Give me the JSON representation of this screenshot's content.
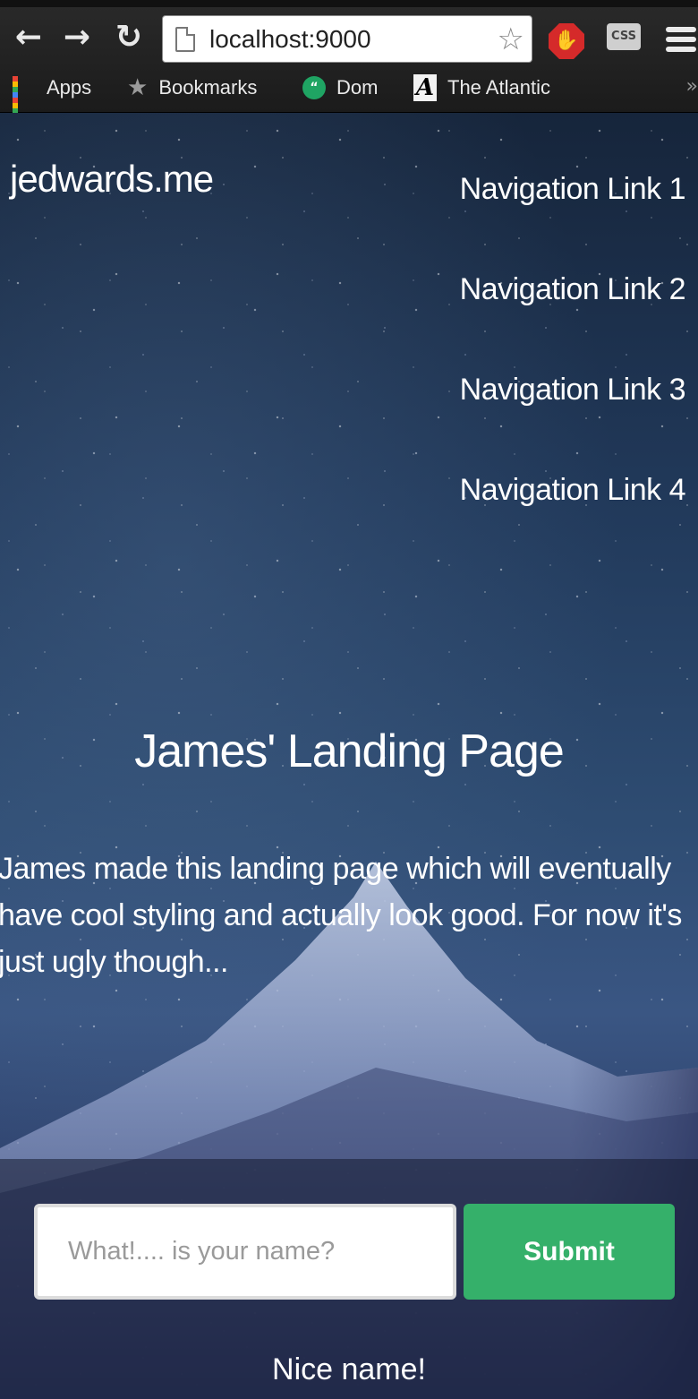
{
  "browser": {
    "url": "localhost:9000",
    "nav_icons": {
      "back": "back-arrow-icon",
      "forward": "forward-arrow-icon",
      "reload": "reload-icon"
    },
    "extensions": [
      {
        "name": "adblock-icon"
      },
      {
        "name": "css-extension-icon",
        "label": "CSS"
      }
    ],
    "bookmarks": [
      {
        "label": "Apps",
        "icon": "apps-grid-icon"
      },
      {
        "label": "Bookmarks",
        "icon": "star-icon"
      },
      {
        "label": "Dom",
        "icon": "hangouts-icon"
      },
      {
        "label": "The Atlantic",
        "icon": "atlantic-icon"
      }
    ],
    "overflow_icon": "»"
  },
  "site": {
    "brand": "jedwards.me",
    "nav_links": [
      "Navigation Link 1",
      "Navigation Link 2",
      "Navigation Link 3",
      "Navigation Link 4"
    ],
    "hero": {
      "title": "James' Landing Page",
      "body": "James made this landing page which will eventually have cool styling and actually look good. For now it's just ugly though..."
    },
    "form": {
      "placeholder": "What!.... is your name?",
      "value": "",
      "submit_label": "Submit",
      "response": "Nice name!"
    }
  },
  "colors": {
    "submit": "#35b06a",
    "adblock": "#d52a2a"
  }
}
